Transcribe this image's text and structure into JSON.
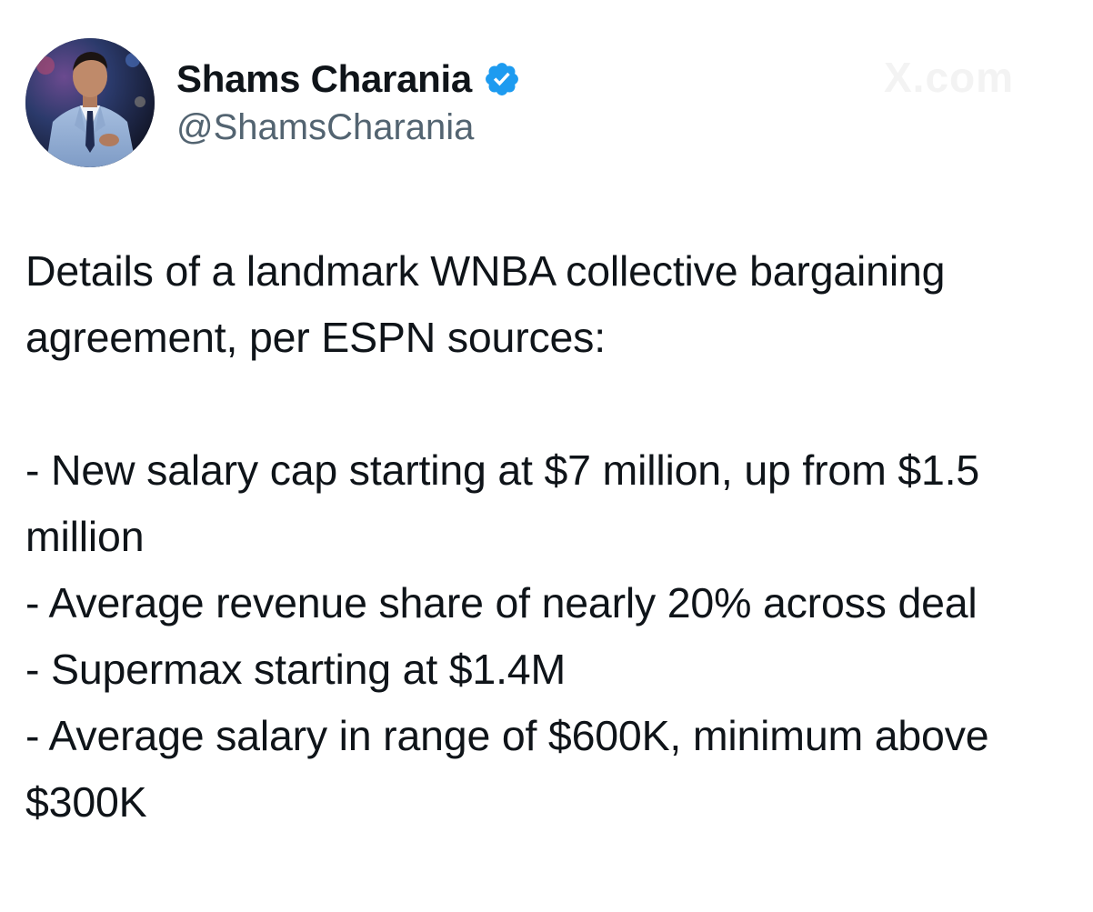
{
  "author": {
    "display_name": "Shams Charania",
    "handle": "@ShamsCharania",
    "verified": true,
    "verified_color": "#1d9bf0",
    "avatar_icon": "profile-photo"
  },
  "watermark": "X.com",
  "tweet": {
    "intro": "Details of a landmark WNBA collective bargaining agreement, per ESPN sources:",
    "bullets": [
      "- New salary cap starting at $7 million, up from $1.5 million",
      "- Average revenue share of nearly 20% across deal",
      "- Supermax starting at $1.4M",
      "- Average salary in range of $600K, minimum above $300K"
    ]
  },
  "colors": {
    "text": "#0f1419",
    "secondary": "#536471",
    "background": "#ffffff"
  }
}
